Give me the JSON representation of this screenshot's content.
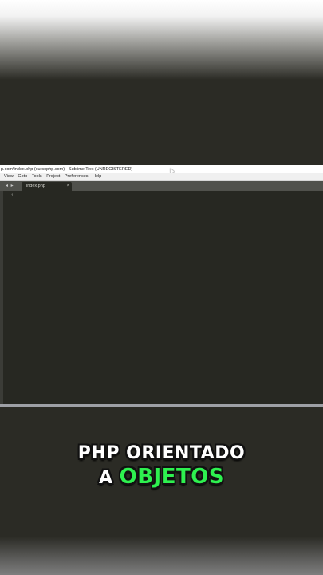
{
  "window": {
    "title": "p.com\\index.php (cursophp.com) - Sublime Text (UNREGISTERED)",
    "menu": [
      "View",
      "Goto",
      "Tools",
      "Project",
      "Preferences",
      "Help"
    ],
    "tab_arrows": "◂ ▸",
    "active_tab": {
      "label": "index.php",
      "close": "×"
    },
    "line_numbers": [
      "1"
    ]
  },
  "caption": {
    "line1": "PHP ORIENTADO",
    "line2_prefix": "A",
    "line2_highlight": "OBJETOS",
    "highlight_color": "#2ef14f"
  },
  "colors": {
    "background": "#2b2b25",
    "editor": "#272822",
    "tab_bar": "#50514c"
  }
}
